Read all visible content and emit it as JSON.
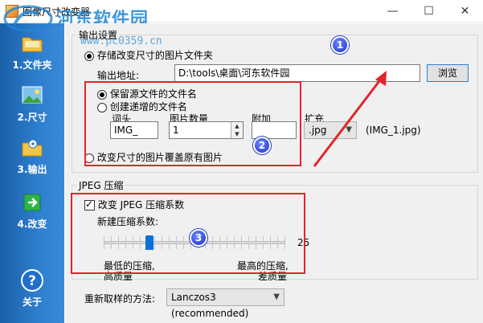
{
  "window": {
    "title": "图像尺寸改变器",
    "minimize": "—",
    "maximize": "☐",
    "close": "✕"
  },
  "watermark": {
    "site_name": "河东软件园",
    "url": "www.pc0359.cn"
  },
  "sidebar": {
    "items": [
      {
        "label": "1.文件夹",
        "icon": "folder-icon"
      },
      {
        "label": "2.尺寸",
        "icon": "image-size-icon"
      },
      {
        "label": "3.输出",
        "icon": "output-folder-icon"
      },
      {
        "label": "4.改变",
        "icon": "arrow-right-icon"
      },
      {
        "label": "关于",
        "icon": "help-icon"
      }
    ]
  },
  "output_settings": {
    "group_title": "输出设置",
    "option_store_folder": "存储改变尺寸的图片文件夹",
    "address_label": "输出地址:",
    "address_value": "D:\\tools\\桌面\\河东软件园",
    "browse_label": "浏览",
    "keep_filename": "保留源文件的文件名",
    "create_filename": "创建递增的文件名",
    "prefix_label": "词头",
    "prefix_value": "IMG_",
    "count_label": "图片数量",
    "count_value": "1",
    "suffix_label": "附加",
    "suffix_value": "",
    "ext_label": "扩充",
    "ext_value": ".jpg",
    "preview": "(IMG_1.jpg)",
    "overwrite_option": "改变尺寸的图片覆盖原有图片"
  },
  "jpeg": {
    "group_title": "JPEG 压缩",
    "change_ratio": "改变 JPEG 压缩系数",
    "new_ratio_label": "新建压缩系数:",
    "ratio_value": "25",
    "ratio_fraction": 0.25,
    "low_label_1": "最低的压缩,",
    "low_label_2": "高质量",
    "high_label_1": "最高的压缩,",
    "high_label_2": "差质量"
  },
  "resample": {
    "label": "重新取样的方法:",
    "value": "Lanczos3 (recommended)"
  },
  "annotations": {
    "badge1": "1",
    "badge2": "2",
    "badge3": "3",
    "red_color": "#e3242b",
    "badge_color": "#1d33c9"
  }
}
